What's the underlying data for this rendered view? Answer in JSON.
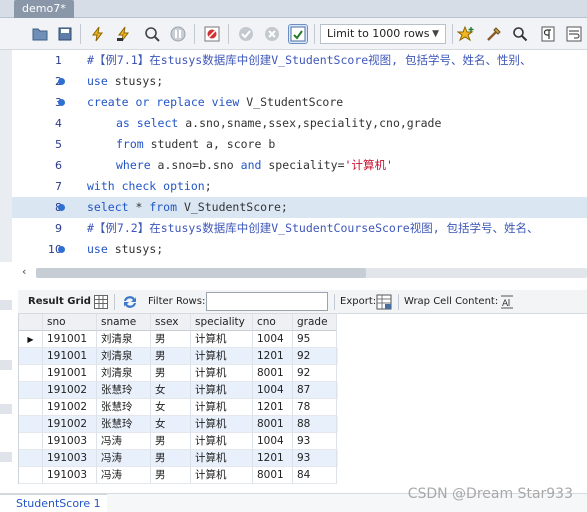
{
  "tab": {
    "title": "demo7*"
  },
  "toolbar": {
    "limit_label": "Limit to 1000 rows"
  },
  "editor": {
    "lines": [
      {
        "num": "1",
        "dot": false,
        "highlight": false,
        "indent": false,
        "html": "<span class=\"cm\">#【例7.1】在stusys数据库中创建V_StudentScore视图, 包括学号、姓名、性别、</span>"
      },
      {
        "num": "2",
        "dot": true,
        "highlight": false,
        "indent": false,
        "html": "<span class=\"kw\">use</span> stusys;"
      },
      {
        "num": "3",
        "dot": true,
        "highlight": false,
        "indent": false,
        "html": "<span class=\"kw\">create or replace view</span> V_StudentScore"
      },
      {
        "num": "4",
        "dot": false,
        "highlight": false,
        "indent": true,
        "html": "<span class=\"kw\">as select</span> a.sno,sname,ssex,speciality,cno,grade"
      },
      {
        "num": "5",
        "dot": false,
        "highlight": false,
        "indent": true,
        "html": "<span class=\"kw\">from</span> student a, score b"
      },
      {
        "num": "6",
        "dot": false,
        "highlight": false,
        "indent": true,
        "html": "<span class=\"kw\">where</span> a.sno=b.sno <span class=\"kw\">and</span> speciality=<span class=\"str\">'计算机'</span>"
      },
      {
        "num": "7",
        "dot": false,
        "highlight": false,
        "indent": false,
        "html": "<span class=\"kw\">with check option</span>;"
      },
      {
        "num": "8",
        "dot": true,
        "highlight": true,
        "indent": false,
        "html": "<span class=\"kw\">select</span> * <span class=\"kw\">from</span> V_StudentScore;"
      },
      {
        "num": "9",
        "dot": false,
        "highlight": false,
        "indent": false,
        "html": "<span class=\"cm\">#【例7.2】在stusys数据库中创建V_StudentCourseScore视图, 包括学号、姓名、</span>"
      },
      {
        "num": "10",
        "dot": true,
        "highlight": false,
        "indent": false,
        "html": "<span class=\"kw\">use</span> stusys;"
      }
    ]
  },
  "results": {
    "result_grid_label": "Result Grid",
    "filter_label": "Filter Rows:",
    "filter_value": "",
    "export_label": "Export:",
    "wrap_label": "Wrap Cell Content:",
    "columns": [
      "sno",
      "sname",
      "ssex",
      "speciality",
      "cno",
      "grade"
    ],
    "rows": [
      [
        "191001",
        "刘清泉",
        "男",
        "计算机",
        "1004",
        "95"
      ],
      [
        "191001",
        "刘清泉",
        "男",
        "计算机",
        "1201",
        "92"
      ],
      [
        "191001",
        "刘清泉",
        "男",
        "计算机",
        "8001",
        "92"
      ],
      [
        "191002",
        "张慧玲",
        "女",
        "计算机",
        "1004",
        "87"
      ],
      [
        "191002",
        "张慧玲",
        "女",
        "计算机",
        "1201",
        "78"
      ],
      [
        "191002",
        "张慧玲",
        "女",
        "计算机",
        "8001",
        "88"
      ],
      [
        "191003",
        "冯涛",
        "男",
        "计算机",
        "1004",
        "93"
      ],
      [
        "191003",
        "冯涛",
        "男",
        "计算机",
        "1201",
        "93"
      ],
      [
        "191003",
        "冯涛",
        "男",
        "计算机",
        "8001",
        "84"
      ]
    ]
  },
  "bottom_tab": {
    "label": "StudentScore 1"
  },
  "watermark": "CSDN @Dream Star933",
  "colors": {
    "keyword": "#2255c4",
    "comment": "#3e57b8",
    "string": "#c8102e",
    "selection": "#dbe6f3"
  }
}
